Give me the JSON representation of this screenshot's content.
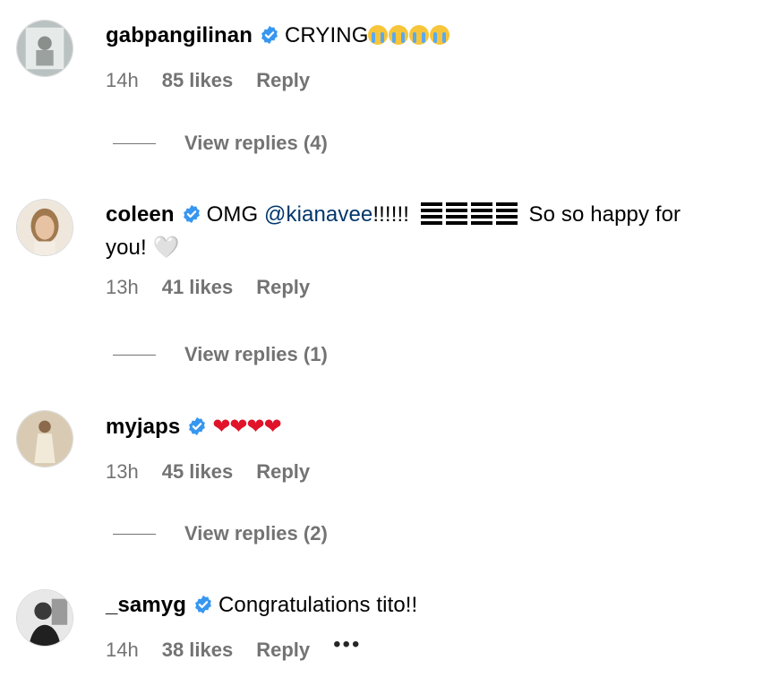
{
  "comments": [
    {
      "username": "gabpangilinan",
      "text": "CRYING",
      "emoji": "😭😭😭😭",
      "time": "14h",
      "likes": "85 likes",
      "reply": "Reply",
      "view_replies": "View replies (4)"
    },
    {
      "username": "coleen",
      "text_before": "OMG ",
      "mention": "@kianavee",
      "text_after": "!!!!!! ",
      "text_end": " So so happy for",
      "text_line2": "you! ",
      "emoji_line2": "🤍",
      "time": "13h",
      "likes": "41 likes",
      "reply": "Reply",
      "view_replies": "View replies (1)"
    },
    {
      "username": "myjaps",
      "emoji": "❤❤❤❤",
      "time": "13h",
      "likes": "45 likes",
      "reply": "Reply",
      "view_replies": "View replies (2)"
    },
    {
      "username": "_samyg",
      "text": "Congratulations tito!!",
      "time": "14h",
      "likes": "38 likes",
      "reply": "Reply",
      "more": "•••"
    }
  ],
  "colors": {
    "verified": "#3797f0",
    "meta": "#737373",
    "mention": "#00376b",
    "heart": "#e0132a"
  }
}
